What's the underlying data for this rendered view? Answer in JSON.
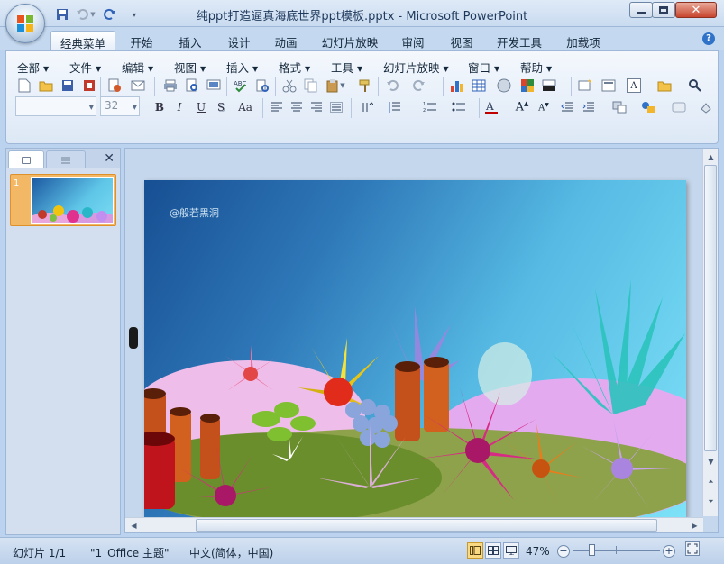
{
  "window": {
    "title": "纯ppt打造逼真海底世界ppt模板.pptx - Microsoft PowerPoint"
  },
  "ribbon_tabs": [
    {
      "label": "经典菜单",
      "active": true
    },
    {
      "label": "开始"
    },
    {
      "label": "插入"
    },
    {
      "label": "设计"
    },
    {
      "label": "动画"
    },
    {
      "label": "幻灯片放映"
    },
    {
      "label": "审阅"
    },
    {
      "label": "视图"
    },
    {
      "label": "开发工具"
    },
    {
      "label": "加载项"
    }
  ],
  "classic_menus": [
    "全部",
    "文件",
    "编辑",
    "视图",
    "插入",
    "格式",
    "工具",
    "幻灯片放映",
    "窗口",
    "帮助"
  ],
  "toolbar": {
    "font_name": "",
    "font_size": "32",
    "format_buttons": [
      "B",
      "I",
      "U",
      "S",
      "Aa"
    ]
  },
  "slides_panel": {
    "slide_number": "1"
  },
  "slide": {
    "watermark": "@般若黑洞"
  },
  "statusbar": {
    "slide_info": "幻灯片 1/1",
    "theme": "\"1_Office 主题\"",
    "language": "中文(简体，中国)",
    "zoom": "47%",
    "zoom_fraction": 0.47
  },
  "colors": {
    "accent": "#f3b865",
    "ribbon_bg": "#dde8f6",
    "title_bg": "#c9dbf0"
  }
}
